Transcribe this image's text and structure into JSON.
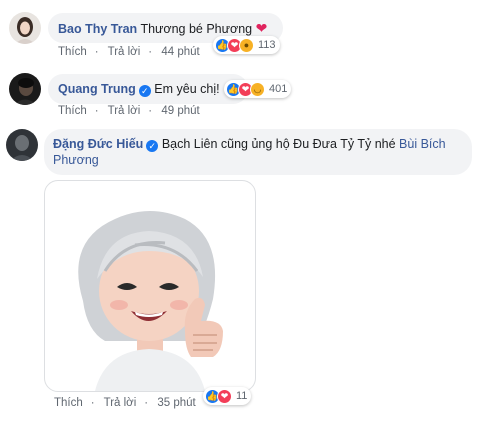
{
  "comments": [
    {
      "author": "Bao Thy Tran",
      "text": "Thương bé Phương",
      "actions": {
        "like": "Thích",
        "reply": "Trả lời",
        "time": "44 phút"
      },
      "reaction_count": "113",
      "reaction_icons": [
        "like-icon",
        "love-icon",
        "wow-icon"
      ]
    },
    {
      "author": "Quang Trung",
      "text": "Em yêu chị!",
      "actions": {
        "like": "Thích",
        "reply": "Trả lời",
        "time": "49 phút"
      },
      "reaction_count": "401",
      "reaction_icons": [
        "like-icon",
        "love-icon",
        "haha-icon"
      ]
    },
    {
      "author": "Đặng Đức Hiếu",
      "text": "Bạch Liên cũng ủng hộ Đu Đưa Tỷ Tỷ nhé",
      "mention_line1": "Bùi Bích",
      "mention_line2": "Phương",
      "actions": {
        "like": "Thích",
        "reply": "Trả lời",
        "time": "35 phút"
      },
      "reaction_count": "11",
      "reaction_icons": [
        "like-icon",
        "love-icon"
      ]
    }
  ],
  "colors": {
    "link": "#385898",
    "bubble": "#f2f3f5",
    "like": "#1877f2",
    "love": "#f33e58",
    "wow": "#f7b125"
  }
}
